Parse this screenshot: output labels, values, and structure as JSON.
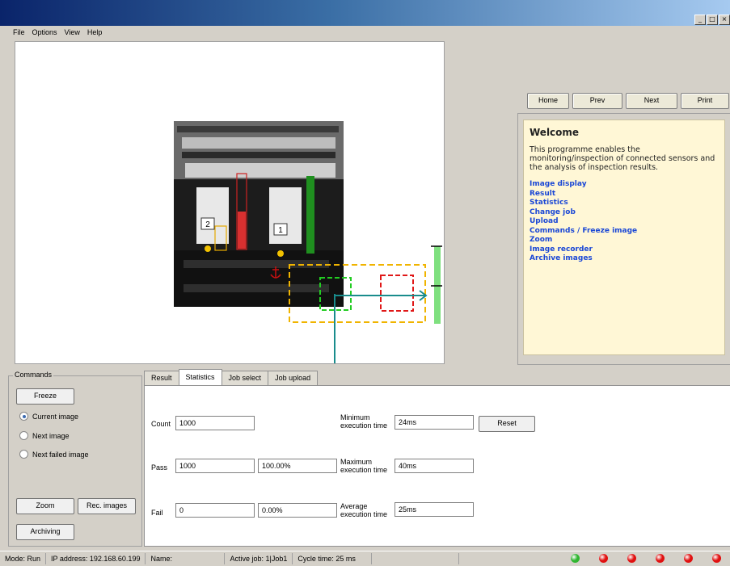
{
  "window": {
    "controls": [
      "_",
      "□",
      "×"
    ]
  },
  "menu": [
    "File",
    "Options",
    "View",
    "Help"
  ],
  "image": {
    "roi_labels": [
      "2",
      "1"
    ],
    "anchor_icon": "anchor-icon",
    "sun_icon": "sun-icon"
  },
  "nav": {
    "home": "Home",
    "prev": "Prev",
    "next": "Next",
    "print": "Print"
  },
  "help": {
    "title": "Welcome",
    "text": "This programme enables the monitoring/inspection of connected sensors and the analysis of inspection results.",
    "links": [
      "Image display",
      "Result",
      "Statistics",
      "Change job",
      "Upload",
      "Commands / Freeze image",
      "Zoom",
      "Image recorder",
      "Archive images"
    ],
    "link_color": "#1a47d6"
  },
  "commands": {
    "title": "Commands",
    "freeze": "Freeze",
    "radios": [
      "Current image",
      "Next image",
      "Next failed image"
    ],
    "zoom": "Zoom",
    "rec": "Rec. images",
    "archiving": "Archiving"
  },
  "tabs": [
    "Result",
    "Statistics",
    "Job select",
    "Job upload"
  ],
  "stats": {
    "count_label": "Count",
    "count": "1000",
    "pass_label": "Pass",
    "pass": "1000",
    "pass_pct": "100.00%",
    "fail_label": "Fail",
    "fail": "0",
    "fail_pct": "0.00%",
    "min_label_1": "Minimum",
    "min_label_2": "execution time",
    "min": "24ms",
    "max_label_1": "Maximum",
    "max_label_2": "execution time",
    "max": "40ms",
    "avg_label_1": "Average",
    "avg_label_2": "execution time",
    "avg": "25ms",
    "reset": "Reset"
  },
  "status": {
    "mode": "Mode:  Run",
    "ip": "IP address:  192.168.60.199",
    "name": "Name:",
    "job": "Active job:  1|Job1",
    "cycle": "Cycle time:  25 ms",
    "leds": [
      "#2fb52f",
      "#e01010",
      "#e01010",
      "#e01010",
      "#e01010",
      "#e01010",
      "#e01010"
    ]
  }
}
